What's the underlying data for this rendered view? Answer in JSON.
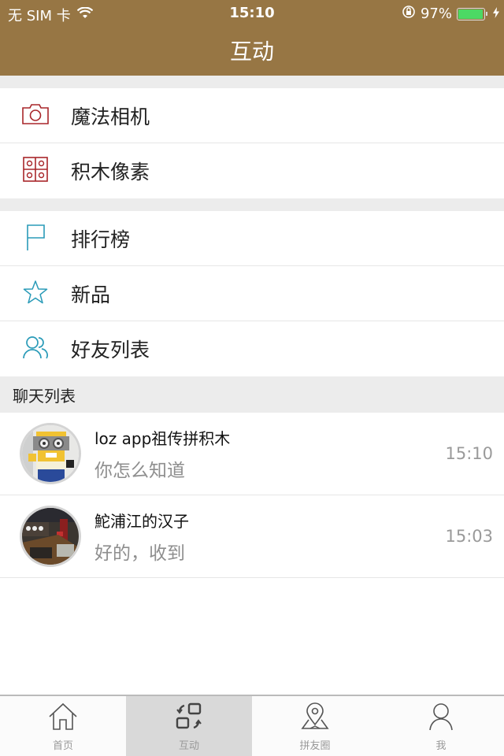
{
  "status_bar": {
    "carrier": "无 SIM 卡",
    "time": "15:10",
    "battery_percent_label": "97%",
    "battery_level": 0.97,
    "charging": true
  },
  "header": {
    "title": "互动"
  },
  "colors": {
    "header_bg": "#977644",
    "icon_red": "#a8262a",
    "icon_teal": "#2a9bb8",
    "battery_green": "#4cd964"
  },
  "menu_group_1": [
    {
      "label": "魔法相机",
      "icon": "camera-icon"
    },
    {
      "label": "积木像素",
      "icon": "pixel-grid-icon"
    }
  ],
  "menu_group_2": [
    {
      "label": "排行榜",
      "icon": "flag-icon"
    },
    {
      "label": "新品",
      "icon": "star-icon"
    },
    {
      "label": "好友列表",
      "icon": "friends-icon"
    }
  ],
  "chat_section": {
    "title": "聊天列表",
    "chats": [
      {
        "name": "loz  app祖传拼积木",
        "message": "你怎么知道",
        "time": "15:10",
        "avatar": "lego-figure-avatar"
      },
      {
        "name": "鮀浦江的汉子",
        "message": "好的，收到",
        "time": "15:03",
        "avatar": "photo-avatar"
      }
    ]
  },
  "tabbar": {
    "tabs": [
      {
        "label": "首页",
        "icon": "home-icon",
        "active": false
      },
      {
        "label": "互动",
        "icon": "interact-icon",
        "active": true
      },
      {
        "label": "拼友圈",
        "icon": "map-pin-icon",
        "active": false
      },
      {
        "label": "我",
        "icon": "person-icon",
        "active": false
      }
    ]
  }
}
